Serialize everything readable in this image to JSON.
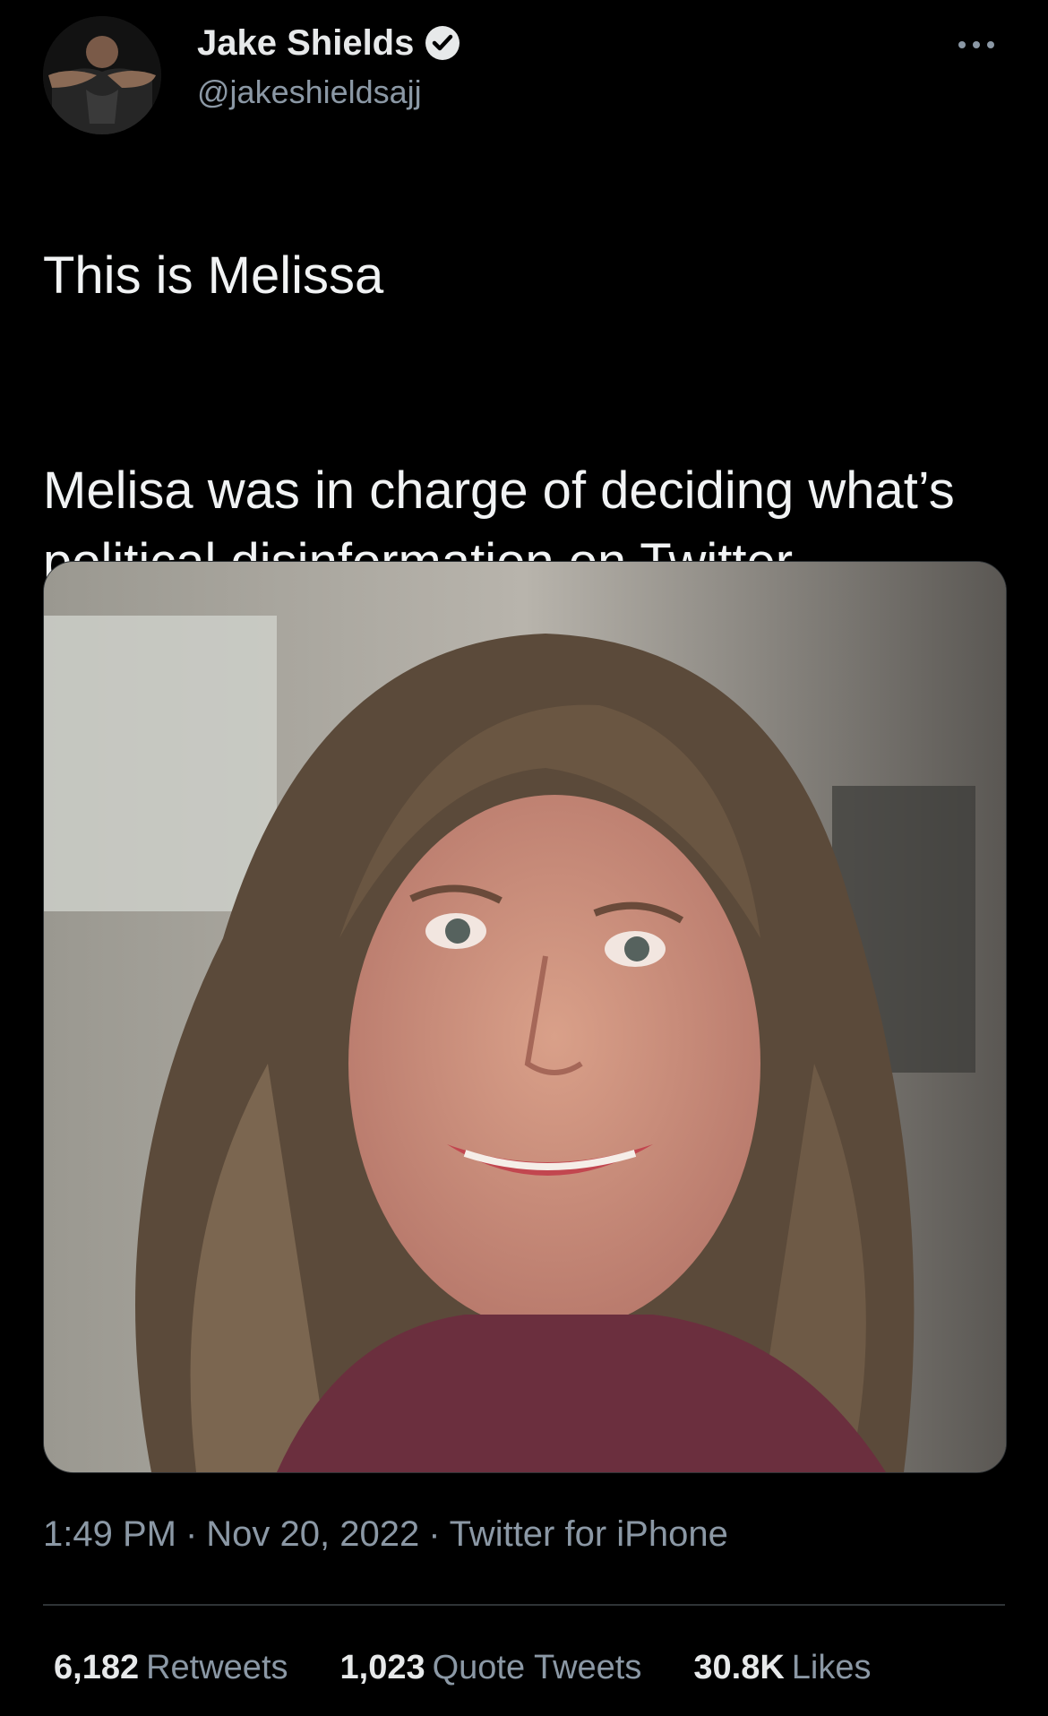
{
  "author": {
    "display_name": "Jake Shields",
    "handle": "@jakeshieldsajj",
    "verified": true
  },
  "tweet": {
    "lines": [
      "This is Melissa",
      "Melisa was in charge of deciding what’s political disinformation on Twitter"
    ]
  },
  "meta": {
    "time": "1:49 PM",
    "separator": "·",
    "date": "Nov 20, 2022",
    "source": "Twitter for iPhone"
  },
  "stats": [
    {
      "count": "6,182",
      "label": "Retweets"
    },
    {
      "count": "1,023",
      "label": "Quote Tweets"
    },
    {
      "count": "30.8K",
      "label": "Likes"
    }
  ],
  "icons": {
    "more": "more-horizontal-icon",
    "verified": "verified-badge-icon"
  },
  "colors": {
    "background": "#000000",
    "text": "#e7e9ea",
    "secondary": "#8b98a5",
    "divider": "#2f3336"
  }
}
